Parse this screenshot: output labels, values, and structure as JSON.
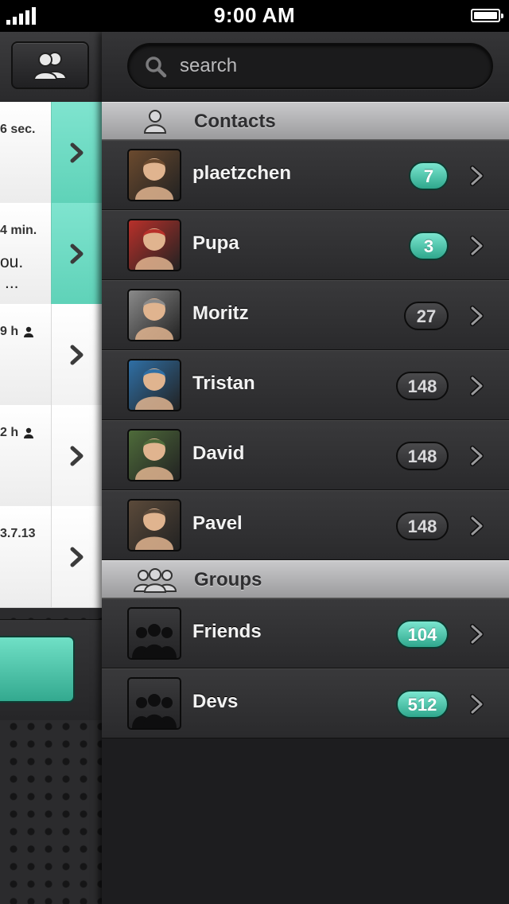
{
  "status_bar": {
    "time": "9:00 AM"
  },
  "chats": [
    {
      "time": "6 sec.",
      "snippet": "",
      "snippet2": "",
      "unread": true,
      "person": false
    },
    {
      "time": "4 min.",
      "snippet": "ou.",
      "snippet2": "...",
      "unread": true,
      "person": false
    },
    {
      "time": "9 h",
      "snippet": "",
      "snippet2": "",
      "unread": false,
      "person": true
    },
    {
      "time": "2 h",
      "snippet": "",
      "snippet2": "",
      "unread": false,
      "person": true
    },
    {
      "time": "3.7.13",
      "snippet": "",
      "snippet2": "",
      "unread": false,
      "person": false
    }
  ],
  "search": {
    "placeholder": "search"
  },
  "sections": {
    "contacts": "Contacts",
    "groups": "Groups"
  },
  "contacts": [
    {
      "name": "plaetzchen",
      "count": "7",
      "highlight": true,
      "avatar": "person-photo"
    },
    {
      "name": "Pupa",
      "count": "3",
      "highlight": true,
      "avatar": "person-photo"
    },
    {
      "name": "Moritz",
      "count": "27",
      "highlight": false,
      "avatar": "person-photo"
    },
    {
      "name": "Tristan",
      "count": "148",
      "highlight": false,
      "avatar": "person-photo"
    },
    {
      "name": "David",
      "count": "148",
      "highlight": false,
      "avatar": "person-photo"
    },
    {
      "name": "Pavel",
      "count": "148",
      "highlight": false,
      "avatar": "person-photo"
    }
  ],
  "groups": [
    {
      "name": "Friends",
      "count": "104",
      "highlight": true,
      "avatar": "group-icon"
    },
    {
      "name": "Devs",
      "count": "512",
      "highlight": true,
      "avatar": "group-icon"
    }
  ],
  "colors": {
    "accent": "#4fcdb3",
    "background": "#1d1d1f",
    "header": "#b4b4b6"
  }
}
